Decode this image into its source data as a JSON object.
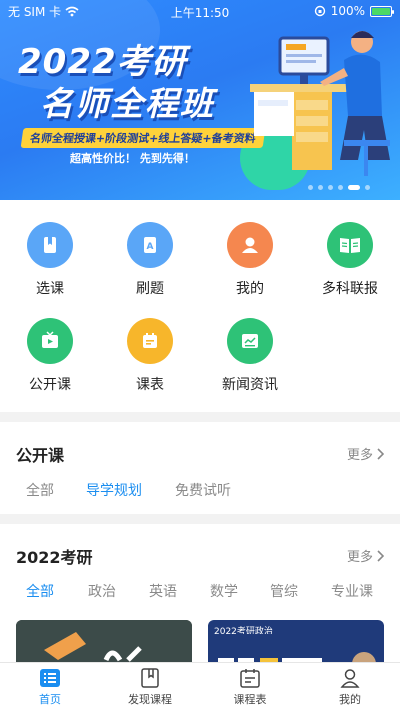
{
  "status_bar": {
    "carrier": "无 SIM 卡",
    "time": "上午11:50",
    "battery": "100%"
  },
  "banner": {
    "title_line1": "2022考研",
    "title_line2": "名师全程班",
    "strip": "名师全程授课+阶段测试+线上答疑+备考资料",
    "slogan": "超高性价比！ 先到先得！",
    "slide_count": 6,
    "active_slide": 5
  },
  "menu": [
    {
      "label": "选课",
      "icon": "book-icon",
      "color": "#5aa6f7"
    },
    {
      "label": "刷题",
      "icon": "exercise-book-icon",
      "color": "#5aa6f7"
    },
    {
      "label": "我的",
      "icon": "user-icon",
      "color": "#f5874f"
    },
    {
      "label": "多科联报",
      "icon": "open-book-icon",
      "color": "#2ec277"
    },
    {
      "label": "公开课",
      "icon": "tv-play-icon",
      "color": "#2ec277"
    },
    {
      "label": "课表",
      "icon": "calendar-icon",
      "color": "#f7b62b"
    },
    {
      "label": "新闻资讯",
      "icon": "news-icon",
      "color": "#2ec277"
    }
  ],
  "public_course": {
    "title": "公开课",
    "more": "更多",
    "tabs": [
      "全部",
      "导学规划",
      "免费试听"
    ],
    "active_tab": 1
  },
  "kaoyan": {
    "title": "2022考研",
    "more": "更多",
    "tabs": [
      "全部",
      "政治",
      "英语",
      "数学",
      "管综",
      "专业课"
    ],
    "active_tab": 0,
    "card2_label": "2022考研政治"
  },
  "bottom_nav": [
    {
      "label": "首页",
      "icon": "home-list-icon",
      "active": true
    },
    {
      "label": "发现课程",
      "icon": "bookmark-icon",
      "active": false
    },
    {
      "label": "课程表",
      "icon": "schedule-icon",
      "active": false
    },
    {
      "label": "我的",
      "icon": "profile-icon",
      "active": false
    }
  ],
  "colors": {
    "accent": "#1b8ef0"
  }
}
